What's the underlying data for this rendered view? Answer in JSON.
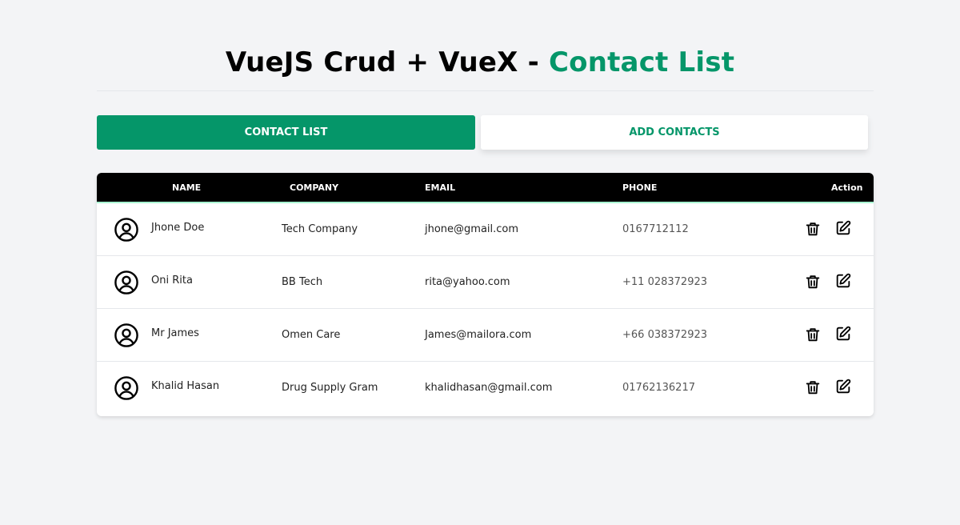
{
  "header": {
    "title_main": "VueJS Crud + VueX - ",
    "title_accent": "Contact List",
    "accent_color": "#059669"
  },
  "nav": {
    "contact_list_label": "CONTACT LIST",
    "add_contacts_label": "ADD CONTACTS"
  },
  "table": {
    "columns": [
      "NAME",
      "COMPANY",
      "EMAIL",
      "PHONE",
      "Action"
    ],
    "rows": [
      {
        "name": "Jhone Doe",
        "company": "Tech Company",
        "email": "jhone@gmail.com",
        "phone": "0167712112"
      },
      {
        "name": "Oni Rita",
        "company": "BB Tech",
        "email": "rita@yahoo.com",
        "phone": "+11 028372923"
      },
      {
        "name": "Mr James",
        "company": "Omen Care",
        "email": "James@mailora.com",
        "phone": "+66 038372923"
      },
      {
        "name": "Khalid Hasan",
        "company": "Drug Supply Gram",
        "email": "khalidhasan@gmail.com",
        "phone": "01762136217"
      }
    ],
    "row_icons": {
      "avatar": "user-circle-icon",
      "delete": "trash-icon",
      "edit": "edit-icon"
    }
  }
}
